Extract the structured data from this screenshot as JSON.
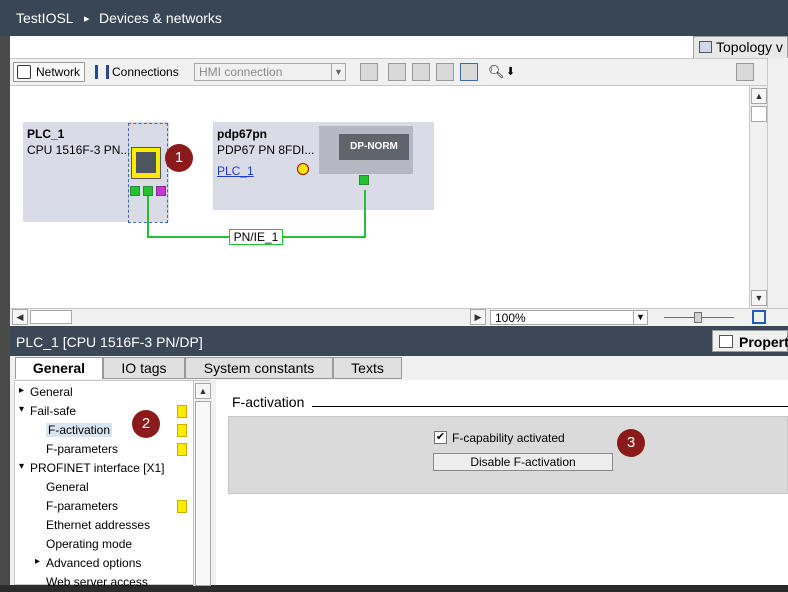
{
  "breadcrumb": {
    "project": "TestIOSL",
    "separator": "▸",
    "page": "Devices & networks"
  },
  "upper": {
    "topology_tab": "Topology v",
    "toolbar": {
      "network_label": "Network",
      "connections_label": "Connections",
      "hmi_connection": "HMI connection"
    },
    "zoom": "100%"
  },
  "devices": {
    "plc": {
      "name": "PLC_1",
      "type": "CPU 1516F-3 PN..."
    },
    "pdp": {
      "name": "pdp67pn",
      "type": "PDP67 PN 8FDI...",
      "link": "PLC_1",
      "module": "DP-NORM"
    }
  },
  "network": {
    "label": "PN/IE_1"
  },
  "badges": [
    "1",
    "2",
    "3"
  ],
  "properties": {
    "title": "PLC_1 [CPU 1516F-3 PN/DP]",
    "right_label": "Properti",
    "tabs": [
      "General",
      "IO tags",
      "System constants",
      "Texts"
    ],
    "nav": [
      {
        "label": "General",
        "indent": 0,
        "arrow": "▸"
      },
      {
        "label": "Fail-safe",
        "indent": 0,
        "arrow": "▾"
      },
      {
        "label": "F-activation",
        "indent": 1,
        "arrow": ""
      },
      {
        "label": "F-parameters",
        "indent": 1,
        "arrow": ""
      },
      {
        "label": "PROFINET interface [X1]",
        "indent": 0,
        "arrow": "▾"
      },
      {
        "label": "General",
        "indent": 1,
        "arrow": ""
      },
      {
        "label": "F-parameters",
        "indent": 1,
        "arrow": ""
      },
      {
        "label": "Ethernet addresses",
        "indent": 1,
        "arrow": ""
      },
      {
        "label": "Operating mode",
        "indent": 1,
        "arrow": ""
      },
      {
        "label": "Advanced options",
        "indent": 1,
        "arrow": "▸"
      },
      {
        "label": "Web server access",
        "indent": 1,
        "arrow": ""
      }
    ],
    "section_title": "F-activation",
    "checkbox_label": "F-capability activated",
    "checkbox_checked": "✔",
    "disable_button": "Disable F-activation"
  },
  "colors": {
    "titlebar": "#394655",
    "badge": "#8b1a1a",
    "network_line": "#22c32e",
    "fail_marker": "#ffea00"
  }
}
